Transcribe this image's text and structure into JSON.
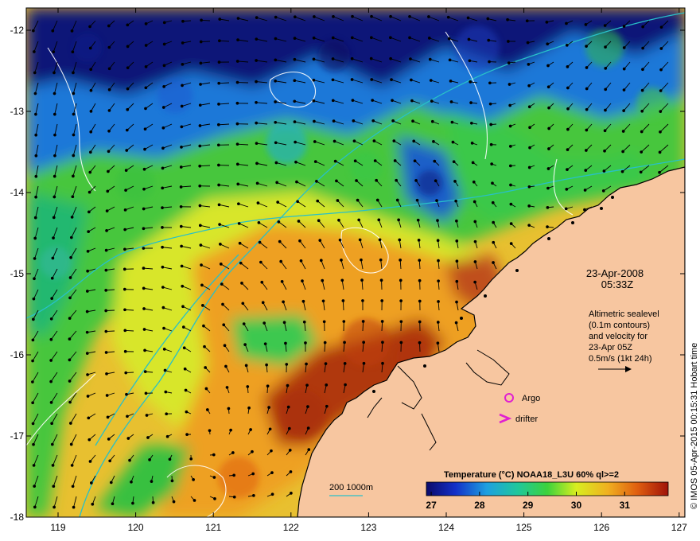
{
  "map": {
    "date": "23-Apr-2008",
    "time": "05:33Z",
    "caption_lines": [
      "Altimetric sealevel",
      "(0.1m contours)",
      "and velocity for",
      "23-Apr 05Z",
      "0.5m/s (1kt 24h)"
    ],
    "credit": "© IMOS 05-Apr-2015 00:15:31 Hobart time",
    "legend_argo": "Argo",
    "legend_drifter": "drifter",
    "depth_legend": "200  1000m",
    "colorbar_title": "Temperature (°C) NOAA18_L3U 60% ql>=2",
    "colorbar_ticks": [
      "27",
      "28",
      "29",
      "30",
      "31"
    ],
    "x_ticks": [
      "119",
      "120",
      "121",
      "122",
      "123",
      "124",
      "125",
      "126",
      "127"
    ],
    "y_ticks": [
      "-12",
      "-13",
      "-14",
      "-15",
      "-16",
      "-17",
      "-18"
    ],
    "colors": {
      "land": "#f7c6a0",
      "argo": "#e020d0",
      "depth_contour": "#28c0c8",
      "sealevel_contour": "#ffffff"
    }
  }
}
